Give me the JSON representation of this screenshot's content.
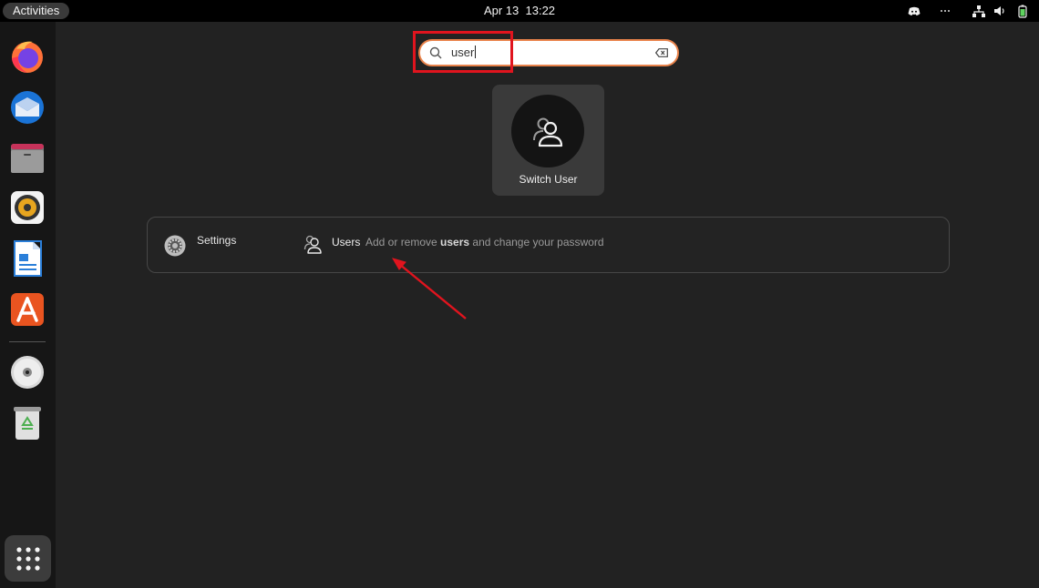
{
  "topbar": {
    "activities_label": "Activities",
    "date": "Apr 13",
    "time": "13:22",
    "tray_icons": [
      "discord-icon",
      "more-icon",
      "network-icon",
      "volume-icon",
      "battery-icon"
    ]
  },
  "dock": {
    "items": [
      {
        "name": "firefox-icon"
      },
      {
        "name": "thunderbird-icon"
      },
      {
        "name": "files-icon"
      },
      {
        "name": "rhythmbox-icon"
      },
      {
        "name": "libreoffice-writer-icon"
      },
      {
        "name": "app-center-icon"
      },
      {
        "name": "disc-icon"
      },
      {
        "name": "trash-icon"
      }
    ],
    "show_apps_icon": "grid-icon"
  },
  "search": {
    "value": "user"
  },
  "app_result": {
    "label": "Switch User",
    "icon": "switch-user-icon"
  },
  "settings_results": {
    "provider": "Settings",
    "item_title": "Users",
    "desc_prefix": "Add or remove ",
    "desc_match": "users",
    "desc_suffix": " and change your password"
  },
  "colors": {
    "accent": "#e9834b",
    "annotation_red": "#e0141e",
    "overview_bg": "#222222"
  }
}
